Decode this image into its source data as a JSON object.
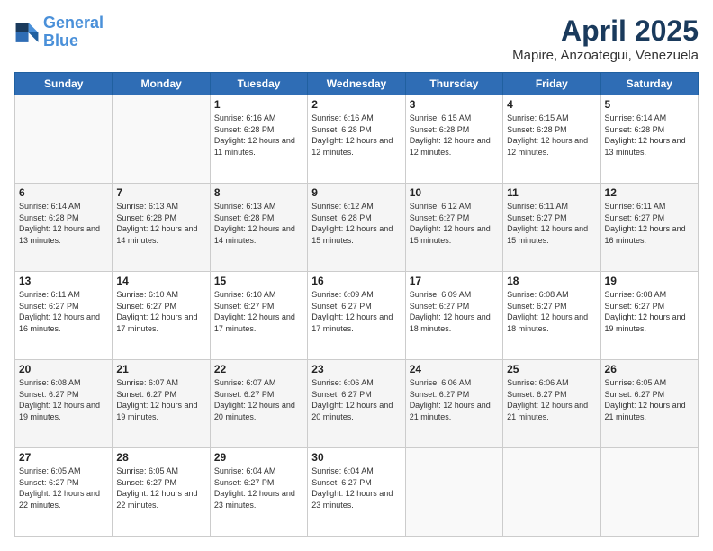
{
  "logo": {
    "line1": "General",
    "line2": "Blue"
  },
  "header": {
    "month": "April 2025",
    "location": "Mapire, Anzoategui, Venezuela"
  },
  "weekdays": [
    "Sunday",
    "Monday",
    "Tuesday",
    "Wednesday",
    "Thursday",
    "Friday",
    "Saturday"
  ],
  "weeks": [
    [
      {
        "day": "",
        "sunrise": "",
        "sunset": "",
        "daylight": ""
      },
      {
        "day": "",
        "sunrise": "",
        "sunset": "",
        "daylight": ""
      },
      {
        "day": "1",
        "sunrise": "Sunrise: 6:16 AM",
        "sunset": "Sunset: 6:28 PM",
        "daylight": "Daylight: 12 hours and 11 minutes."
      },
      {
        "day": "2",
        "sunrise": "Sunrise: 6:16 AM",
        "sunset": "Sunset: 6:28 PM",
        "daylight": "Daylight: 12 hours and 12 minutes."
      },
      {
        "day": "3",
        "sunrise": "Sunrise: 6:15 AM",
        "sunset": "Sunset: 6:28 PM",
        "daylight": "Daylight: 12 hours and 12 minutes."
      },
      {
        "day": "4",
        "sunrise": "Sunrise: 6:15 AM",
        "sunset": "Sunset: 6:28 PM",
        "daylight": "Daylight: 12 hours and 12 minutes."
      },
      {
        "day": "5",
        "sunrise": "Sunrise: 6:14 AM",
        "sunset": "Sunset: 6:28 PM",
        "daylight": "Daylight: 12 hours and 13 minutes."
      }
    ],
    [
      {
        "day": "6",
        "sunrise": "Sunrise: 6:14 AM",
        "sunset": "Sunset: 6:28 PM",
        "daylight": "Daylight: 12 hours and 13 minutes."
      },
      {
        "day": "7",
        "sunrise": "Sunrise: 6:13 AM",
        "sunset": "Sunset: 6:28 PM",
        "daylight": "Daylight: 12 hours and 14 minutes."
      },
      {
        "day": "8",
        "sunrise": "Sunrise: 6:13 AM",
        "sunset": "Sunset: 6:28 PM",
        "daylight": "Daylight: 12 hours and 14 minutes."
      },
      {
        "day": "9",
        "sunrise": "Sunrise: 6:12 AM",
        "sunset": "Sunset: 6:28 PM",
        "daylight": "Daylight: 12 hours and 15 minutes."
      },
      {
        "day": "10",
        "sunrise": "Sunrise: 6:12 AM",
        "sunset": "Sunset: 6:27 PM",
        "daylight": "Daylight: 12 hours and 15 minutes."
      },
      {
        "day": "11",
        "sunrise": "Sunrise: 6:11 AM",
        "sunset": "Sunset: 6:27 PM",
        "daylight": "Daylight: 12 hours and 15 minutes."
      },
      {
        "day": "12",
        "sunrise": "Sunrise: 6:11 AM",
        "sunset": "Sunset: 6:27 PM",
        "daylight": "Daylight: 12 hours and 16 minutes."
      }
    ],
    [
      {
        "day": "13",
        "sunrise": "Sunrise: 6:11 AM",
        "sunset": "Sunset: 6:27 PM",
        "daylight": "Daylight: 12 hours and 16 minutes."
      },
      {
        "day": "14",
        "sunrise": "Sunrise: 6:10 AM",
        "sunset": "Sunset: 6:27 PM",
        "daylight": "Daylight: 12 hours and 17 minutes."
      },
      {
        "day": "15",
        "sunrise": "Sunrise: 6:10 AM",
        "sunset": "Sunset: 6:27 PM",
        "daylight": "Daylight: 12 hours and 17 minutes."
      },
      {
        "day": "16",
        "sunrise": "Sunrise: 6:09 AM",
        "sunset": "Sunset: 6:27 PM",
        "daylight": "Daylight: 12 hours and 17 minutes."
      },
      {
        "day": "17",
        "sunrise": "Sunrise: 6:09 AM",
        "sunset": "Sunset: 6:27 PM",
        "daylight": "Daylight: 12 hours and 18 minutes."
      },
      {
        "day": "18",
        "sunrise": "Sunrise: 6:08 AM",
        "sunset": "Sunset: 6:27 PM",
        "daylight": "Daylight: 12 hours and 18 minutes."
      },
      {
        "day": "19",
        "sunrise": "Sunrise: 6:08 AM",
        "sunset": "Sunset: 6:27 PM",
        "daylight": "Daylight: 12 hours and 19 minutes."
      }
    ],
    [
      {
        "day": "20",
        "sunrise": "Sunrise: 6:08 AM",
        "sunset": "Sunset: 6:27 PM",
        "daylight": "Daylight: 12 hours and 19 minutes."
      },
      {
        "day": "21",
        "sunrise": "Sunrise: 6:07 AM",
        "sunset": "Sunset: 6:27 PM",
        "daylight": "Daylight: 12 hours and 19 minutes."
      },
      {
        "day": "22",
        "sunrise": "Sunrise: 6:07 AM",
        "sunset": "Sunset: 6:27 PM",
        "daylight": "Daylight: 12 hours and 20 minutes."
      },
      {
        "day": "23",
        "sunrise": "Sunrise: 6:06 AM",
        "sunset": "Sunset: 6:27 PM",
        "daylight": "Daylight: 12 hours and 20 minutes."
      },
      {
        "day": "24",
        "sunrise": "Sunrise: 6:06 AM",
        "sunset": "Sunset: 6:27 PM",
        "daylight": "Daylight: 12 hours and 21 minutes."
      },
      {
        "day": "25",
        "sunrise": "Sunrise: 6:06 AM",
        "sunset": "Sunset: 6:27 PM",
        "daylight": "Daylight: 12 hours and 21 minutes."
      },
      {
        "day": "26",
        "sunrise": "Sunrise: 6:05 AM",
        "sunset": "Sunset: 6:27 PM",
        "daylight": "Daylight: 12 hours and 21 minutes."
      }
    ],
    [
      {
        "day": "27",
        "sunrise": "Sunrise: 6:05 AM",
        "sunset": "Sunset: 6:27 PM",
        "daylight": "Daylight: 12 hours and 22 minutes."
      },
      {
        "day": "28",
        "sunrise": "Sunrise: 6:05 AM",
        "sunset": "Sunset: 6:27 PM",
        "daylight": "Daylight: 12 hours and 22 minutes."
      },
      {
        "day": "29",
        "sunrise": "Sunrise: 6:04 AM",
        "sunset": "Sunset: 6:27 PM",
        "daylight": "Daylight: 12 hours and 23 minutes."
      },
      {
        "day": "30",
        "sunrise": "Sunrise: 6:04 AM",
        "sunset": "Sunset: 6:27 PM",
        "daylight": "Daylight: 12 hours and 23 minutes."
      },
      {
        "day": "",
        "sunrise": "",
        "sunset": "",
        "daylight": ""
      },
      {
        "day": "",
        "sunrise": "",
        "sunset": "",
        "daylight": ""
      },
      {
        "day": "",
        "sunrise": "",
        "sunset": "",
        "daylight": ""
      }
    ]
  ]
}
